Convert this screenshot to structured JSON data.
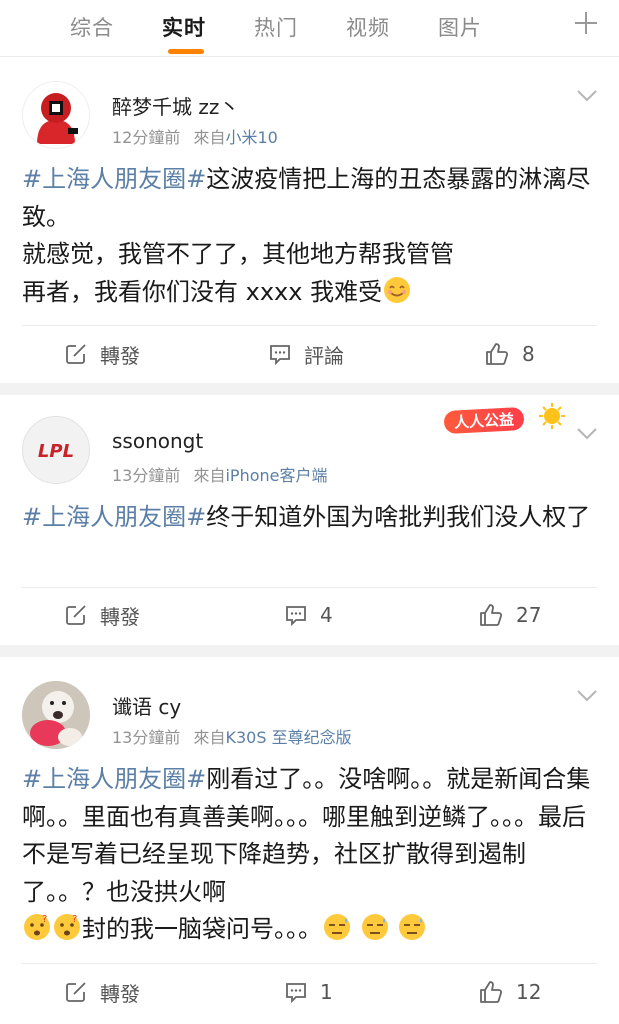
{
  "tabs": [
    {
      "label": "综合",
      "active": false
    },
    {
      "label": "实时",
      "active": true
    },
    {
      "label": "热门",
      "active": false
    },
    {
      "label": "视频",
      "active": false
    },
    {
      "label": "图片",
      "active": false
    }
  ],
  "accent_color": "#ff8200",
  "link_color": "#5b7fa6",
  "posts": [
    {
      "username": "醉梦千城 zz丶",
      "time": "12分鐘前",
      "from_label": "來自",
      "source": "小米10",
      "topic": "#上海人朋友圈#",
      "text_after_topic": "这波疫情把上海的丑态暴露的淋漓尽致。",
      "text_line2": "就感觉，我管不了了，其他地方帮我管管",
      "text_line3": "再者，我看你们没有 xxxx 我难受",
      "emoji": "smile-emoji",
      "repost_label": "轉發",
      "comment_label": "評論",
      "like_count": "8"
    },
    {
      "username": "ssonongt",
      "avatar_text": "LPL",
      "time": "13分鐘前",
      "from_label": "來自",
      "source": "iPhone客户端",
      "badge": "人人公益",
      "topic": "#上海人朋友圈#",
      "text_after_topic": "终于知道外国为啥批判我们没人权了",
      "repost_label": "轉發",
      "comment_count": "4",
      "like_count": "27"
    },
    {
      "username": "谶语 cy",
      "time": "13分鐘前",
      "from_label": "來自",
      "source": "K30S 至尊纪念版",
      "topic": "#上海人朋友圈#",
      "text_after_topic": "刚看过了。。没啥啊。。就是新闻合集啊。。里面也有真善美啊。。。哪里触到逆鳞了。。。最后不是写着已经呈现下降趋势，社区扩散得到遏制了。。？也没拱火啊",
      "text_tail": "封的我一脑袋问号。。。",
      "repost_label": "轉發",
      "comment_count": "1",
      "like_count": "12"
    }
  ]
}
